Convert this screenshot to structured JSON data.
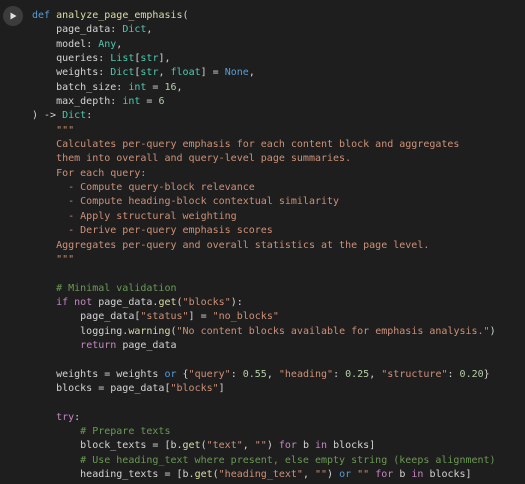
{
  "cell": {
    "run_button_icon": "play-icon",
    "lines": [
      [
        {
          "t": "def ",
          "c": "keyword"
        },
        {
          "t": "analyze_page_emphasis",
          "c": "function"
        },
        {
          "t": "(",
          "c": "default"
        }
      ],
      [
        {
          "t": "    page_data",
          "c": "default"
        },
        {
          "t": ": ",
          "c": "default"
        },
        {
          "t": "Dict",
          "c": "type"
        },
        {
          "t": ",",
          "c": "default"
        }
      ],
      [
        {
          "t": "    model",
          "c": "default"
        },
        {
          "t": ": ",
          "c": "default"
        },
        {
          "t": "Any",
          "c": "type"
        },
        {
          "t": ",",
          "c": "default"
        }
      ],
      [
        {
          "t": "    queries",
          "c": "default"
        },
        {
          "t": ": ",
          "c": "default"
        },
        {
          "t": "List",
          "c": "type"
        },
        {
          "t": "[",
          "c": "default"
        },
        {
          "t": "str",
          "c": "type"
        },
        {
          "t": "],",
          "c": "default"
        }
      ],
      [
        {
          "t": "    weights",
          "c": "default"
        },
        {
          "t": ": ",
          "c": "default"
        },
        {
          "t": "Dict",
          "c": "type"
        },
        {
          "t": "[",
          "c": "default"
        },
        {
          "t": "str",
          "c": "type"
        },
        {
          "t": ", ",
          "c": "default"
        },
        {
          "t": "float",
          "c": "type"
        },
        {
          "t": "] = ",
          "c": "default"
        },
        {
          "t": "None",
          "c": "keyword"
        },
        {
          "t": ",",
          "c": "default"
        }
      ],
      [
        {
          "t": "    batch_size",
          "c": "default"
        },
        {
          "t": ": ",
          "c": "default"
        },
        {
          "t": "int",
          "c": "type"
        },
        {
          "t": " = ",
          "c": "default"
        },
        {
          "t": "16",
          "c": "number"
        },
        {
          "t": ",",
          "c": "default"
        }
      ],
      [
        {
          "t": "    max_depth",
          "c": "default"
        },
        {
          "t": ": ",
          "c": "default"
        },
        {
          "t": "int",
          "c": "type"
        },
        {
          "t": " = ",
          "c": "default"
        },
        {
          "t": "6",
          "c": "number"
        }
      ],
      [
        {
          "t": ") -> ",
          "c": "default"
        },
        {
          "t": "Dict",
          "c": "type"
        },
        {
          "t": ":",
          "c": "default"
        }
      ],
      [
        {
          "t": "    \"\"\"",
          "c": "string"
        }
      ],
      [
        {
          "t": "    Calculates per-query emphasis for each content block and aggregates",
          "c": "string"
        }
      ],
      [
        {
          "t": "    them into overall and query-level page summaries.",
          "c": "string"
        }
      ],
      [
        {
          "t": "    For each query:",
          "c": "string"
        }
      ],
      [
        {
          "t": "      - Compute query-block relevance",
          "c": "string"
        }
      ],
      [
        {
          "t": "      - Compute heading-block contextual similarity",
          "c": "string"
        }
      ],
      [
        {
          "t": "      - Apply structural weighting",
          "c": "string"
        }
      ],
      [
        {
          "t": "      - Derive per-query emphasis scores",
          "c": "string"
        }
      ],
      [
        {
          "t": "    Aggregates per-query and overall statistics at the page level.",
          "c": "string"
        }
      ],
      [
        {
          "t": "    \"\"\"",
          "c": "string"
        }
      ],
      [
        {
          "t": "",
          "c": "default"
        }
      ],
      [
        {
          "t": "    # Minimal validation",
          "c": "comment"
        }
      ],
      [
        {
          "t": "    ",
          "c": "default"
        },
        {
          "t": "if not ",
          "c": "control"
        },
        {
          "t": "page_data.",
          "c": "default"
        },
        {
          "t": "get",
          "c": "function"
        },
        {
          "t": "(",
          "c": "default"
        },
        {
          "t": "\"blocks\"",
          "c": "string"
        },
        {
          "t": "):",
          "c": "default"
        }
      ],
      [
        {
          "t": "        page_data[",
          "c": "default"
        },
        {
          "t": "\"status\"",
          "c": "string"
        },
        {
          "t": "] = ",
          "c": "default"
        },
        {
          "t": "\"no_blocks\"",
          "c": "string"
        }
      ],
      [
        {
          "t": "        logging.",
          "c": "default"
        },
        {
          "t": "warning",
          "c": "function"
        },
        {
          "t": "(",
          "c": "default"
        },
        {
          "t": "\"No content blocks available for emphasis analysis.\"",
          "c": "string"
        },
        {
          "t": ")",
          "c": "default"
        }
      ],
      [
        {
          "t": "        ",
          "c": "default"
        },
        {
          "t": "return ",
          "c": "control"
        },
        {
          "t": "page_data",
          "c": "default"
        }
      ],
      [
        {
          "t": "",
          "c": "default"
        }
      ],
      [
        {
          "t": "    weights = weights ",
          "c": "default"
        },
        {
          "t": "or ",
          "c": "keyword"
        },
        {
          "t": "{",
          "c": "default"
        },
        {
          "t": "\"query\"",
          "c": "string"
        },
        {
          "t": ": ",
          "c": "default"
        },
        {
          "t": "0.55",
          "c": "number"
        },
        {
          "t": ", ",
          "c": "default"
        },
        {
          "t": "\"heading\"",
          "c": "string"
        },
        {
          "t": ": ",
          "c": "default"
        },
        {
          "t": "0.25",
          "c": "number"
        },
        {
          "t": ", ",
          "c": "default"
        },
        {
          "t": "\"structure\"",
          "c": "string"
        },
        {
          "t": ": ",
          "c": "default"
        },
        {
          "t": "0.20",
          "c": "number"
        },
        {
          "t": "}",
          "c": "default"
        }
      ],
      [
        {
          "t": "    blocks = page_data[",
          "c": "default"
        },
        {
          "t": "\"blocks\"",
          "c": "string"
        },
        {
          "t": "]",
          "c": "default"
        }
      ],
      [
        {
          "t": "",
          "c": "default"
        }
      ],
      [
        {
          "t": "    ",
          "c": "default"
        },
        {
          "t": "try",
          "c": "control"
        },
        {
          "t": ":",
          "c": "default"
        }
      ],
      [
        {
          "t": "        # Prepare texts",
          "c": "comment"
        }
      ],
      [
        {
          "t": "        block_texts = [b.",
          "c": "default"
        },
        {
          "t": "get",
          "c": "function"
        },
        {
          "t": "(",
          "c": "default"
        },
        {
          "t": "\"text\"",
          "c": "string"
        },
        {
          "t": ", ",
          "c": "default"
        },
        {
          "t": "\"\"",
          "c": "string"
        },
        {
          "t": ") ",
          "c": "default"
        },
        {
          "t": "for ",
          "c": "control"
        },
        {
          "t": "b ",
          "c": "default"
        },
        {
          "t": "in ",
          "c": "control"
        },
        {
          "t": "blocks]",
          "c": "default"
        }
      ],
      [
        {
          "t": "        # Use heading_text where present, else empty string (keeps alignment)",
          "c": "comment"
        }
      ],
      [
        {
          "t": "        heading_texts = [b.",
          "c": "default"
        },
        {
          "t": "get",
          "c": "function"
        },
        {
          "t": "(",
          "c": "default"
        },
        {
          "t": "\"heading_text\"",
          "c": "string"
        },
        {
          "t": ", ",
          "c": "default"
        },
        {
          "t": "\"\"",
          "c": "string"
        },
        {
          "t": ") ",
          "c": "default"
        },
        {
          "t": "or ",
          "c": "keyword"
        },
        {
          "t": "\"\"",
          "c": "string"
        },
        {
          "t": " ",
          "c": "default"
        },
        {
          "t": "for ",
          "c": "control"
        },
        {
          "t": "b ",
          "c": "default"
        },
        {
          "t": "in ",
          "c": "control"
        },
        {
          "t": "blocks]",
          "c": "default"
        }
      ]
    ]
  }
}
